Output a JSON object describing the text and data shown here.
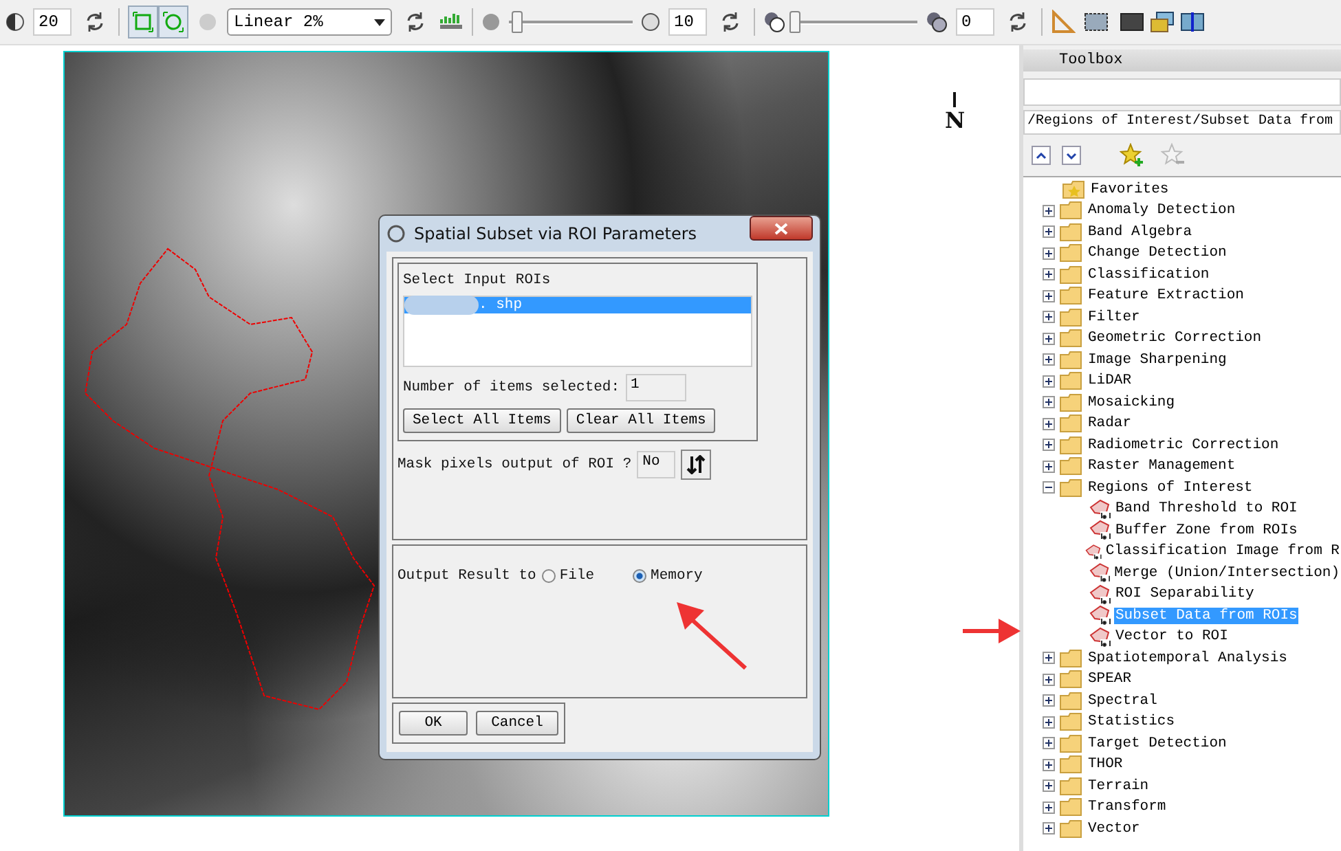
{
  "toolbar": {
    "brightness": {
      "value": "20"
    },
    "view_buttons": [
      {
        "selected": true
      },
      {
        "selected": true
      }
    ],
    "stretch": {
      "value": "Linear 2%"
    },
    "sharpen": {
      "level": 0.05,
      "value": "10"
    },
    "transparency": {
      "level": 0,
      "value": "0"
    }
  },
  "north_arrow": {
    "label": "N"
  },
  "dialog": {
    "title": "Spatial Subset via ROI Parameters",
    "roi_group": {
      "label": "Select Input ROIs",
      "items": [
        {
          "label": ". shp",
          "selected": true
        }
      ],
      "count_label": "Number of items selected:",
      "count": "1",
      "buttons": [
        "Select All Items",
        "Clear All Items"
      ]
    },
    "mask": {
      "label": "Mask pixels output of ROI ?",
      "value": "No"
    },
    "output": {
      "label": "Output Result to",
      "options": [
        {
          "label": "File",
          "selected": false
        },
        {
          "label": "Memory",
          "selected": true
        }
      ]
    },
    "buttons": [
      "OK",
      "Cancel"
    ]
  },
  "toolbox": {
    "title": "Toolbox",
    "path": "/Regions of Interest/Subset Data from",
    "tree": [
      {
        "kind": "favorites",
        "label": "Favorites"
      },
      {
        "kind": "folder",
        "label": "Anomaly Detection",
        "expanded": false
      },
      {
        "kind": "folder",
        "label": "Band Algebra",
        "expanded": false
      },
      {
        "kind": "folder",
        "label": "Change Detection",
        "expanded": false
      },
      {
        "kind": "folder",
        "label": "Classification",
        "expanded": false
      },
      {
        "kind": "folder",
        "label": "Feature Extraction",
        "expanded": false
      },
      {
        "kind": "folder",
        "label": "Filter",
        "expanded": false
      },
      {
        "kind": "folder",
        "label": "Geometric Correction",
        "expanded": false
      },
      {
        "kind": "folder",
        "label": "Image Sharpening",
        "expanded": false
      },
      {
        "kind": "folder",
        "label": "LiDAR",
        "expanded": false
      },
      {
        "kind": "folder",
        "label": "Mosaicking",
        "expanded": false
      },
      {
        "kind": "folder",
        "label": "Radar",
        "expanded": false
      },
      {
        "kind": "folder",
        "label": "Radiometric Correction",
        "expanded": false
      },
      {
        "kind": "folder",
        "label": "Raster Management",
        "expanded": false
      },
      {
        "kind": "folder",
        "label": "Regions of Interest",
        "expanded": true,
        "children": [
          {
            "kind": "tool",
            "label": "Band Threshold to ROI",
            "selected": false
          },
          {
            "kind": "tool",
            "label": "Buffer Zone from ROIs",
            "selected": false
          },
          {
            "kind": "tool",
            "label": "Classification Image from R",
            "selected": false
          },
          {
            "kind": "tool",
            "label": "Merge (Union/Intersection)",
            "selected": false
          },
          {
            "kind": "tool",
            "label": "ROI Separability",
            "selected": false
          },
          {
            "kind": "tool",
            "label": "Subset Data from ROIs",
            "selected": true
          },
          {
            "kind": "tool",
            "label": "Vector to ROI",
            "selected": false
          }
        ]
      },
      {
        "kind": "folder",
        "label": "Spatiotemporal Analysis",
        "expanded": false
      },
      {
        "kind": "folder",
        "label": "SPEAR",
        "expanded": false
      },
      {
        "kind": "folder",
        "label": "Spectral",
        "expanded": false
      },
      {
        "kind": "folder",
        "label": "Statistics",
        "expanded": false
      },
      {
        "kind": "folder",
        "label": "Target Detection",
        "expanded": false
      },
      {
        "kind": "folder",
        "label": "THOR",
        "expanded": false
      },
      {
        "kind": "folder",
        "label": "Terrain",
        "expanded": false
      },
      {
        "kind": "folder",
        "label": "Transform",
        "expanded": false
      },
      {
        "kind": "folder",
        "label": "Vector",
        "expanded": false
      }
    ]
  }
}
